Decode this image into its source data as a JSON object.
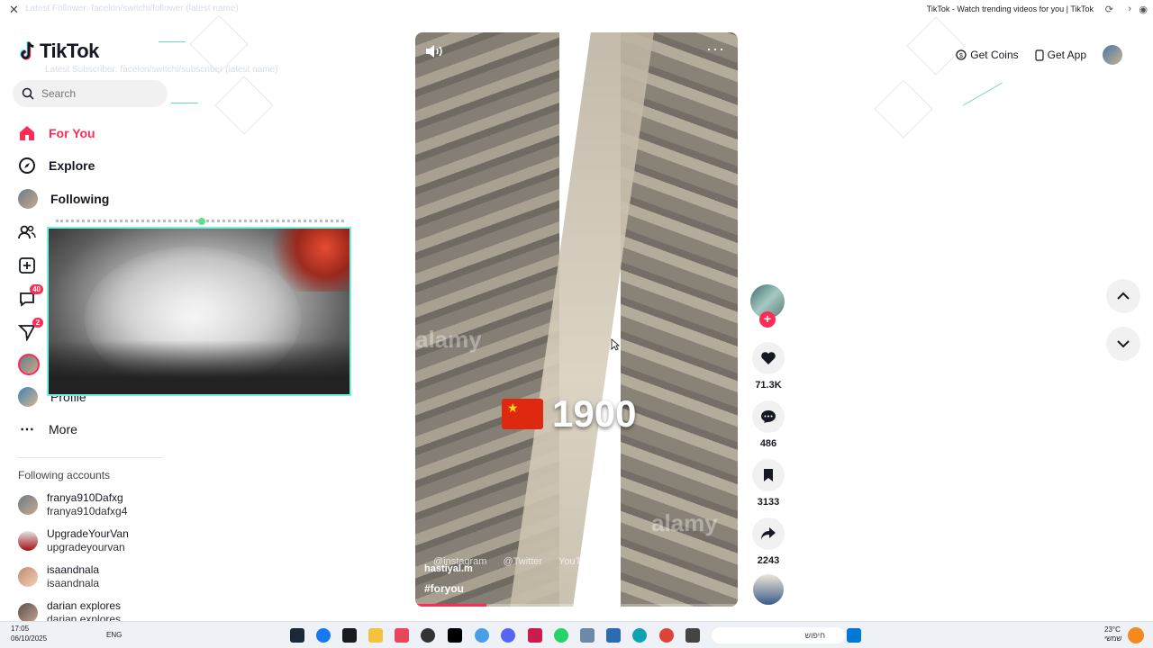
{
  "browser": {
    "tab_title": "TikTok - Watch trending videos for you | TikTok",
    "ghost_text_1": "Latest Follower: facelon/switchi/follower (latest name)",
    "ghost_text_2": "Latest Subscriber: facelon/switchi/subscriber (latest name)"
  },
  "sidebar": {
    "logo": "TikTok",
    "search_placeholder": "Search",
    "nav": [
      {
        "label": "For You"
      },
      {
        "label": "Explore"
      },
      {
        "label": "Following"
      },
      {
        "label": "Friends"
      },
      {
        "label": "Upload"
      },
      {
        "label": "Activity",
        "badge": "40"
      },
      {
        "label": "Messages",
        "badge": "2"
      },
      {
        "label": "LIVE"
      },
      {
        "label": "Profile"
      },
      {
        "label": "More"
      }
    ],
    "following_title": "Following accounts",
    "following": [
      {
        "name": "franya910Dafxg",
        "handle": "franya910dafxg4"
      },
      {
        "name": "UpgradeYourVan",
        "handle": "upgradeyourvan"
      },
      {
        "name": "isaandnala",
        "handle": "isaandnala"
      },
      {
        "name": "darian explores",
        "handle": "darian explores"
      }
    ]
  },
  "video": {
    "year": "1900",
    "flag": "CN",
    "author": "hastiyal.m",
    "hashtag": "#foryou",
    "watermark": "alamy",
    "socials": [
      "@instagram",
      "@Twitter",
      "YouTube"
    ],
    "progress": 0.22
  },
  "actions": {
    "likes": "71.3K",
    "comments": "486",
    "saves": "3133",
    "shares": "2243"
  },
  "topright": {
    "coins": "Get Coins",
    "app": "Get App"
  },
  "taskbar": {
    "time": "17:05",
    "date": "06/10/2025",
    "lang": "ENG",
    "search_placeholder": "חיפוש",
    "temp": "23°C",
    "weather": "שמשי"
  },
  "colors": {
    "accent": "#fe2c55",
    "webcam_border": "#6ff2e0"
  }
}
